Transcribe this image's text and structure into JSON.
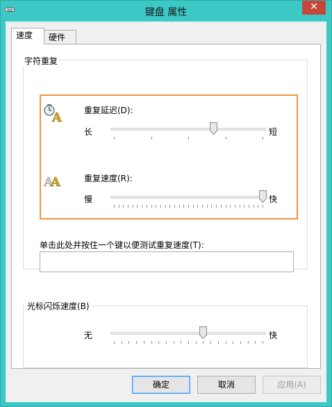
{
  "window": {
    "title": "键盘 属性",
    "close_glyph": "✕"
  },
  "tabs": [
    {
      "label": "速度",
      "selected": true
    },
    {
      "label": "硬件",
      "selected": false
    }
  ],
  "repeat_group": {
    "label": "字符重复",
    "delay": {
      "label": "重复延迟(D):",
      "left": "长",
      "right": "短",
      "value_fraction": 0.667,
      "tick_count": 4,
      "icon": "clock-letter-icon"
    },
    "rate": {
      "label": "重复速度(R):",
      "left": "慢",
      "right": "快",
      "value_fraction": 1.0,
      "tick_count": 32,
      "icon": "double-letter-icon"
    },
    "test_label": "单击此处并按住一个键以便测试重复速度(T):",
    "test_value": ""
  },
  "cursor_group": {
    "label": "光标闪烁速度(B)",
    "left": "无",
    "right": "快",
    "value_fraction": 0.6,
    "tick_count": 20
  },
  "buttons": {
    "ok": "确定",
    "cancel": "取消",
    "apply": "应用(A)"
  },
  "colors": {
    "accent": "#3cc9c6",
    "highlight": "#f0923c",
    "close": "#c7463a"
  }
}
